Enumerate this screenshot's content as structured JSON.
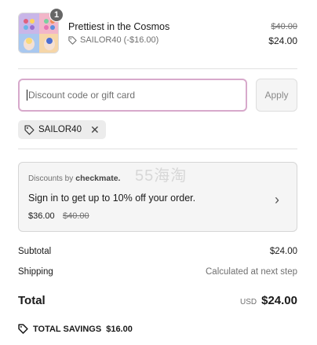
{
  "product": {
    "name": "Prettiest in the Cosmos",
    "quantity": "1",
    "discount_label": "SAILOR40 (-$16.00)",
    "original_price": "$40.00",
    "price": "$24.00"
  },
  "discount": {
    "placeholder": "Discount code or gift card",
    "apply_label": "Apply",
    "applied_code": "SAILOR40"
  },
  "promo": {
    "by_label": "Discounts by",
    "brand": "checkmate.",
    "watermark": "55海淘",
    "message": "Sign in to get up to 10% off your order.",
    "new_price": "$36.00",
    "old_price": "$40.00"
  },
  "summary": {
    "subtotal_label": "Subtotal",
    "subtotal_value": "$24.00",
    "shipping_label": "Shipping",
    "shipping_value": "Calculated at next step",
    "total_label": "Total",
    "currency": "USD",
    "total_value": "$24.00",
    "savings_label": "TOTAL SAVINGS",
    "savings_value": "$16.00"
  },
  "colors": {
    "input_focus_border": "#d7a9cb",
    "muted_text": "#707070"
  }
}
